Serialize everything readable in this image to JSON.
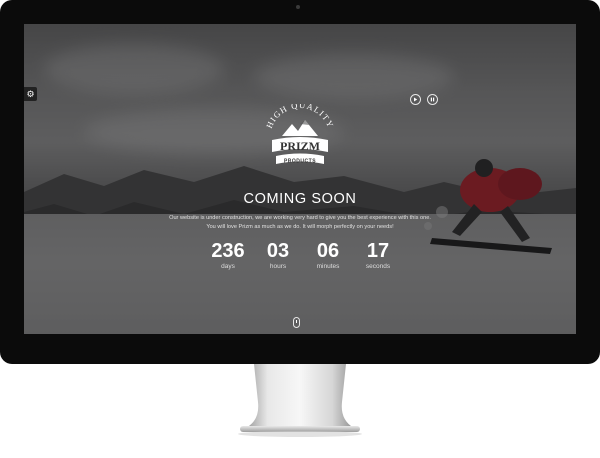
{
  "logo": {
    "top_text": "HIGH QUALITY",
    "brand": "PRIZM",
    "bottom_text": "PRODUCTS"
  },
  "hero": {
    "heading": "COMING SOON",
    "description_line1": "Our website is under construction, we are working very hard to give you the best experience with this one.",
    "description_line2": "You will love Prizm as much as we do. It will morph perfectly on your needs!"
  },
  "countdown": [
    {
      "value": "236",
      "label": "days"
    },
    {
      "value": "03",
      "label": "hours"
    },
    {
      "value": "06",
      "label": "minutes"
    },
    {
      "value": "17",
      "label": "seconds"
    }
  ],
  "icons": {
    "side_tab": "settings-gear-icon",
    "play": "play-icon",
    "pause": "pause-icon",
    "scroll": "mouse-scroll-icon"
  },
  "colors": {
    "monitor_bezel": "#0b0b0b",
    "overlay": "#141416",
    "text": "#ffffff",
    "rider_jacket": "#c0202c"
  }
}
